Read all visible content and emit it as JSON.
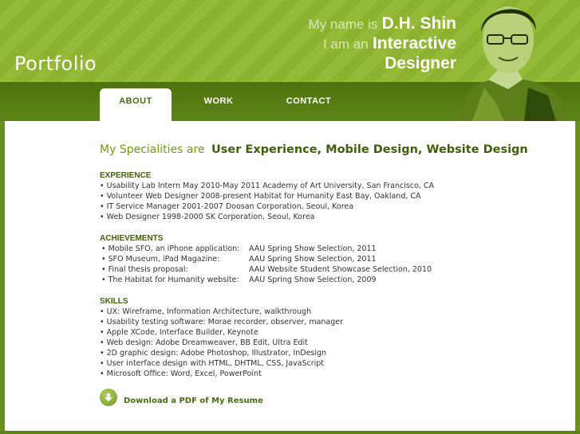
{
  "header": {
    "logo": "Portfolio",
    "tagline": {
      "line1_small": "My name is",
      "line1_big": "D.H. Shin",
      "line2_small": "I am an",
      "line2_big": "Interactive",
      "line3": "Designer"
    }
  },
  "nav": {
    "tabs": [
      {
        "label": "ABOUT",
        "active": true
      },
      {
        "label": "WORK",
        "active": false
      },
      {
        "label": "CONTACT",
        "active": false
      }
    ]
  },
  "headline": {
    "lead": "My Specialities are",
    "main": "User Experience, Mobile Design, Website Design"
  },
  "experience": {
    "title": "EXPERIENCE",
    "items": [
      "• Usability Lab Intern May 2010-May 2011  Academy of Art University, San Francisco, CA",
      "• Volunteer Web Designer 2008-present  Habitat for Humanity East Bay, Oakland, CA",
      "• IT Service Manager 2001-2007  Doosan Corporation, Seoul, Korea",
      "• Web Designer 1998-2000  SK Corporation, Seoul, Korea"
    ]
  },
  "achievements": {
    "title": "ACHIEVEMENTS",
    "rows": [
      {
        "item": "• Mobile SFO, an iPhone application:",
        "award": "AAU Spring Show Selection, 2011"
      },
      {
        "item": "• SFO Museum, iPad Magazine:",
        "award": "AAU Spring Show Selection, 2011"
      },
      {
        "item": "• Final thesis proposal:",
        "award": "AAU Website Student Showcase Selection, 2010"
      },
      {
        "item": "• The Habitat for Humanity website:",
        "award": "AAU Spring Show Selection, 2009"
      }
    ]
  },
  "skills": {
    "title": "SKILLS",
    "items": [
      "• UX: Wireframe, Information Architecture, walkthrough",
      "• Usability testing software: Morae recorder, observer, manager",
      "• Apple XCode, Interface Builder, Keynote",
      "• Web design: Adobe Dreamweaver, BB Edit, Ultra Edit",
      "• 2D graphic design: Adobe Photoshop, Illustrator, InDesign",
      "• User interface design with HTML, DHTML, CSS, JavaScript",
      "• Microsoft Office: Word, Excel, PowerPoint"
    ]
  },
  "download": {
    "label": "Download a PDF of My Resume",
    "icon": "download-arrow-icon"
  },
  "colors": {
    "brand_green": "#8cb230",
    "nav_green": "#4f7210",
    "title_green": "#3f5f0c"
  }
}
